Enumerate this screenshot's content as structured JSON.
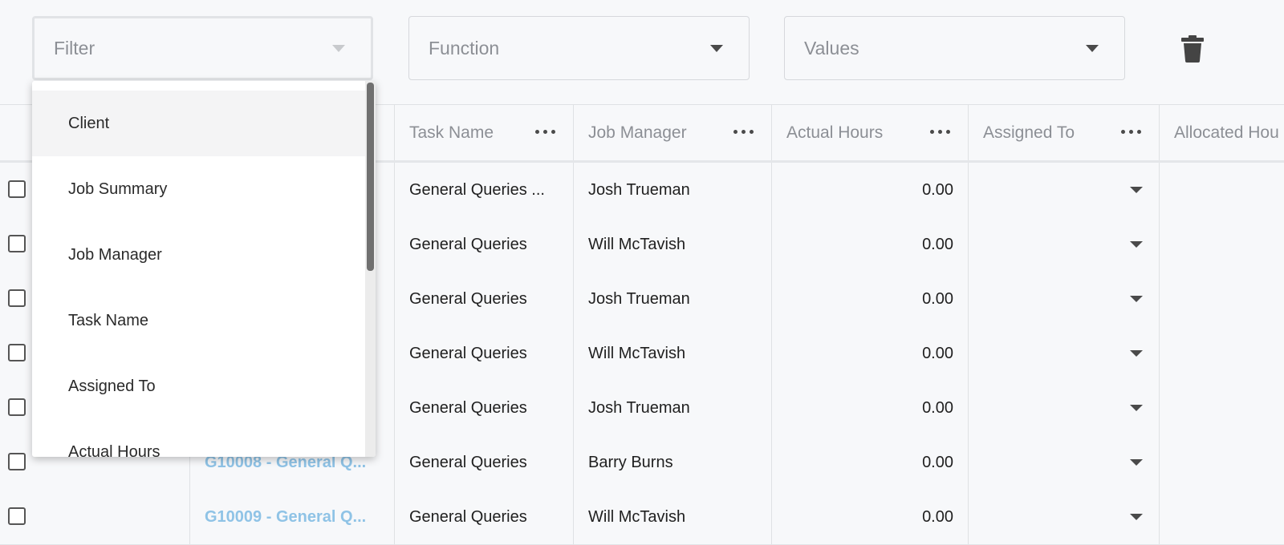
{
  "filters": {
    "filter_label": "Filter",
    "function_label": "Function",
    "values_label": "Values"
  },
  "icons": {
    "delete": "trash-icon",
    "menu": "more-dots-icon",
    "dropdown": "caret-down-icon"
  },
  "grid": {
    "columns": [
      {
        "label": ""
      },
      {
        "label": ""
      },
      {
        "label": "Task Name"
      },
      {
        "label": "Job Manager"
      },
      {
        "label": "Actual Hours"
      },
      {
        "label": "Assigned To"
      },
      {
        "label": "Allocated Hou"
      }
    ],
    "rows": [
      {
        "job": "",
        "task": "General Queries ...",
        "manager": "Josh Trueman",
        "hours": "0.00"
      },
      {
        "job": "",
        "task": "General Queries",
        "manager": "Will McTavish",
        "hours": "0.00"
      },
      {
        "job": "",
        "task": "General Queries",
        "manager": "Josh Trueman",
        "hours": "0.00"
      },
      {
        "job": "",
        "task": "General Queries",
        "manager": "Will McTavish",
        "hours": "0.00"
      },
      {
        "job": "",
        "task": "General Queries",
        "manager": "Josh Trueman",
        "hours": "0.00"
      },
      {
        "job": "G10008 - General Q...",
        "task": "General Queries",
        "manager": "Barry Burns",
        "hours": "0.00"
      },
      {
        "job": "G10009 - General Q...",
        "task": "General Queries",
        "manager": "Will McTavish",
        "hours": "0.00"
      }
    ]
  },
  "dropdown": {
    "options": [
      "Client",
      "Job Summary",
      "Job Manager",
      "Task Name",
      "Assigned To",
      "Actual Hours"
    ]
  },
  "colors": {
    "link": "#8fc3e6",
    "background": "#f7f8fa",
    "hover": "#f4f4f5"
  }
}
